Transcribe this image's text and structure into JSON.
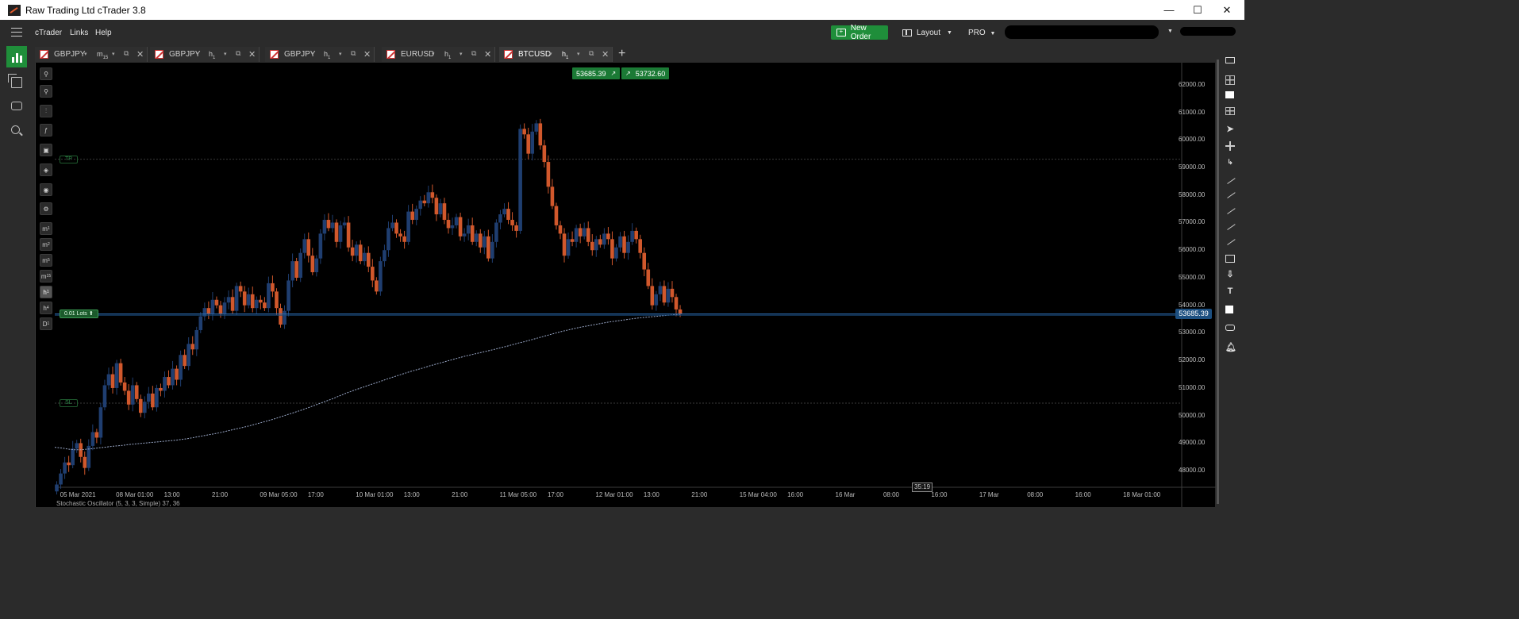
{
  "window": {
    "title": "Raw Trading Ltd cTrader 3.8",
    "minimize": "—",
    "maximize": "☐",
    "close": "✕"
  },
  "menu": {
    "items": [
      "cTrader",
      "Links",
      "Help"
    ],
    "new_order_label": "New Order",
    "layout_label": "Layout",
    "pro_label": "PRO",
    "caret": "▼"
  },
  "tabs": [
    {
      "symbol": "GBPJPY",
      "tf": "m",
      "tf_sub": "15",
      "active": false
    },
    {
      "symbol": "GBPJPY",
      "tf": "h",
      "tf_sub": "1",
      "active": false
    },
    {
      "symbol": "GBPJPY",
      "tf": "h",
      "tf_sub": "1",
      "active": false
    },
    {
      "symbol": "EURUSD",
      "tf": "h",
      "tf_sub": "1",
      "active": false
    },
    {
      "symbol": "BTCUSD",
      "tf": "h",
      "tf_sub": "1",
      "active": true
    }
  ],
  "tab_icons": {
    "dropdown": "▾",
    "popout": "⧉",
    "close": "✕",
    "new_tab": "+"
  },
  "chart_tools": {
    "timeframes": [
      {
        "label": "m",
        "sub": "1",
        "selected": false
      },
      {
        "label": "m",
        "sub": "2",
        "selected": false
      },
      {
        "label": "m",
        "sub": "5",
        "selected": false
      },
      {
        "label": "m",
        "sub": "15",
        "selected": false
      },
      {
        "label": "h",
        "sub": "1",
        "selected": true
      },
      {
        "label": "h",
        "sub": "4",
        "selected": false
      },
      {
        "label": "D",
        "sub": "1",
        "selected": false
      }
    ]
  },
  "quote": {
    "sell": "53685.39",
    "buy": "53732.60",
    "sell_arrow": "↗",
    "buy_arrow": "↗"
  },
  "position": {
    "lots_label": "0.01 Lots",
    "lots_arrow": "⬆",
    "tp_label": "TP",
    "sl_label": "SL"
  },
  "countdown": "35:19",
  "indicator": "Stochastic Oscillator (5, 3, 3, Simple) 37, 36",
  "colors": {
    "bull": "#1f3e70",
    "bear": "#d1582c",
    "accent_green": "#1f8e3a",
    "background": "#000000"
  },
  "chart_data": {
    "type": "candlestick",
    "symbol": "BTCUSD",
    "timeframe": "h1",
    "current_price": 53685.39,
    "current_price_label": "53685.39",
    "tp_price": 59300,
    "sl_price": 50450,
    "ylim": [
      47400,
      62800
    ],
    "y_ticks": [
      {
        "value": 62000,
        "label": "62000.00"
      },
      {
        "value": 61000,
        "label": "61000.00"
      },
      {
        "value": 60000,
        "label": "60000.00"
      },
      {
        "value": 59000,
        "label": "59000.00"
      },
      {
        "value": 58000,
        "label": "58000.00"
      },
      {
        "value": 57000,
        "label": "57000.00"
      },
      {
        "value": 56000,
        "label": "56000.00"
      },
      {
        "value": 55000,
        "label": "55000.00"
      },
      {
        "value": 54000,
        "label": "54000.00"
      },
      {
        "value": 53000,
        "label": "53000.00"
      },
      {
        "value": 52000,
        "label": "52000.00"
      },
      {
        "value": 51000,
        "label": "51000.00"
      },
      {
        "value": 50000,
        "label": "50000.00"
      },
      {
        "value": 49000,
        "label": "49000.00"
      },
      {
        "value": 48000,
        "label": "48000.00"
      }
    ],
    "x_ticks": [
      {
        "index": 4,
        "label": "05 Mar 2021"
      },
      {
        "index": 18,
        "label": "08 Mar 01:00"
      },
      {
        "index": 30,
        "label": "13:00"
      },
      {
        "index": 42,
        "label": "21:00"
      },
      {
        "index": 54,
        "label": "09 Mar 05:00"
      },
      {
        "index": 66,
        "label": "17:00"
      },
      {
        "index": 78,
        "label": "10 Mar 01:00"
      },
      {
        "index": 90,
        "label": "13:00"
      },
      {
        "index": 102,
        "label": "21:00"
      },
      {
        "index": 114,
        "label": "11 Mar 05:00"
      },
      {
        "index": 126,
        "label": "17:00"
      },
      {
        "index": 138,
        "label": "12 Mar 01:00"
      },
      {
        "index": 150,
        "label": "13:00"
      },
      {
        "index": 162,
        "label": "21:00"
      },
      {
        "index": 174,
        "label": "15 Mar 04:00"
      },
      {
        "index": 186,
        "label": "16:00"
      },
      {
        "index": 198,
        "label": "16 Mar"
      },
      {
        "index": 210,
        "label": "08:00"
      },
      {
        "index": 222,
        "label": "16:00"
      },
      {
        "index": 234,
        "label": "17 Mar"
      },
      {
        "index": 246,
        "label": "08:00"
      },
      {
        "index": 258,
        "label": "16:00"
      },
      {
        "index": 270,
        "label": "18 Mar 01:00"
      }
    ],
    "x_count": 282,
    "closes": [
      47500,
      47900,
      48300,
      48200,
      48800,
      49000,
      48500,
      48100,
      48900,
      49400,
      49200,
      50300,
      51100,
      51500,
      51000,
      51900,
      51200,
      50900,
      50400,
      51100,
      50600,
      50100,
      50500,
      50800,
      50300,
      51000,
      50900,
      51400,
      51100,
      51700,
      51300,
      52200,
      51800,
      52600,
      52400,
      53100,
      53600,
      53900,
      53700,
      54200,
      54000,
      53700,
      54100,
      54300,
      53800,
      54700,
      54500,
      54000,
      54400,
      53900,
      54200,
      54100,
      53900,
      54800,
      54500,
      53900,
      53300,
      53800,
      54900,
      55600,
      55000,
      55900,
      56400,
      55800,
      55200,
      55700,
      56600,
      57100,
      56800,
      57000,
      56300,
      56900,
      57000,
      56100,
      55800,
      56200,
      55600,
      55900,
      55400,
      54900,
      54500,
      55600,
      56000,
      56800,
      57000,
      56600,
      56500,
      56300,
      57400,
      57100,
      57500,
      57800,
      57700,
      58100,
      57900,
      57300,
      57700,
      57100,
      56800,
      56900,
      57200,
      56500,
      56600,
      56900,
      56300,
      56600,
      56100,
      56500,
      55700,
      56300,
      57000,
      57300,
      57500,
      57100,
      56900,
      56700,
      60400,
      60200,
      59500,
      60300,
      60600,
      59800,
      59200,
      58300,
      57600,
      56900,
      56600,
      55800,
      56400,
      56300,
      56800,
      56500,
      56800,
      56300,
      56000,
      56400,
      56200,
      56600,
      56400,
      55700,
      56100,
      56500,
      55900,
      56300,
      56700,
      56400,
      55900,
      55300,
      54700,
      54000,
      54400,
      54700,
      54100,
      54600,
      54300,
      53850,
      53685
    ],
    "ma_values": [
      48850,
      48820,
      48780,
      48760,
      48760,
      48780,
      48800,
      48830,
      48850,
      48880,
      48900,
      48920,
      48950,
      48970,
      48990,
      49010,
      49030,
      49050,
      49070,
      49090,
      49110,
      49140,
      49170,
      49210,
      49250,
      49290,
      49330,
      49370,
      49420,
      49470,
      49520,
      49570,
      49620,
      49680,
      49740,
      49800,
      49860,
      49930,
      50000,
      50070,
      50140,
      50210,
      50290,
      50370,
      50450,
      50530,
      50610,
      50700,
      50790,
      50870,
      50950,
      51020,
      51100,
      51170,
      51240,
      51320,
      51390,
      51460,
      51530,
      51600,
      51660,
      51720,
      51790,
      51850,
      51910,
      51970,
      52030,
      52090,
      52150,
      52200,
      52250,
      52300,
      52350,
      52400,
      52460,
      52510,
      52570,
      52630,
      52680,
      52740,
      52800,
      52860,
      52920,
      52980,
      53040,
      53090,
      53140,
      53190,
      53230,
      53270,
      53310,
      53350,
      53390,
      53420,
      53450,
      53480,
      53510,
      53540,
      53560,
      53580,
      53600,
      53620,
      53640,
      53660,
      53680
    ]
  }
}
